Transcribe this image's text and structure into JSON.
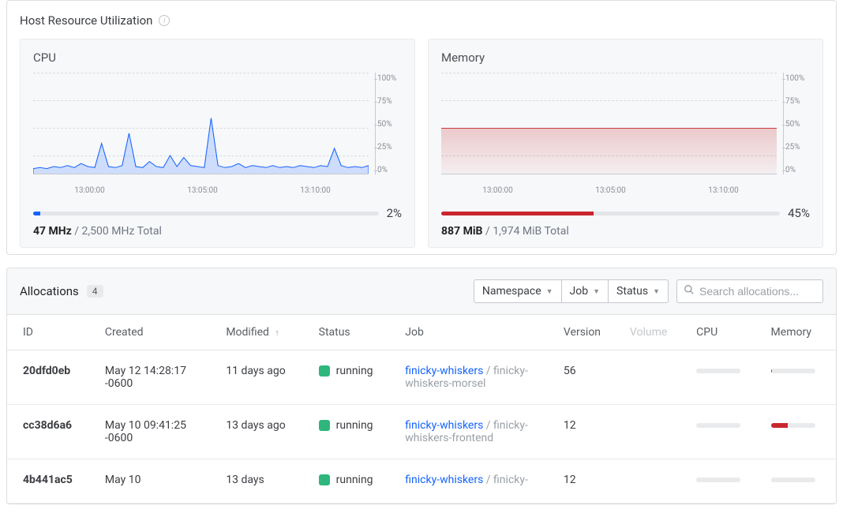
{
  "host_resource": {
    "title": "Host Resource Utilization",
    "cpu": {
      "label": "CPU",
      "pct": 2,
      "primary": "47 MHz",
      "secondary": "/ 2,500 MHz Total",
      "bar_color": "#1563ff"
    },
    "memory": {
      "label": "Memory",
      "pct": 45,
      "primary": "887 MiB",
      "secondary": "/ 1,974 MiB Total",
      "bar_color": "#c9262d"
    },
    "y_ticks": [
      "100%",
      "75%",
      "50%",
      "25%",
      "0%"
    ],
    "x_ticks": [
      "13:00:00",
      "13:05:00",
      "13:10:00"
    ]
  },
  "chart_data": [
    {
      "type": "line",
      "title": "CPU",
      "ylabel": "percent",
      "ylim": [
        0,
        100
      ],
      "x_ticks": [
        "13:00:00",
        "13:05:00",
        "13:10:00"
      ],
      "series": [
        {
          "name": "cpu",
          "color": "#1563ff",
          "values": [
            5,
            6,
            5,
            7,
            6,
            8,
            6,
            10,
            7,
            6,
            30,
            7,
            6,
            8,
            40,
            7,
            6,
            12,
            7,
            6,
            18,
            7,
            16,
            8,
            7,
            6,
            55,
            8,
            6,
            7,
            10,
            6,
            8,
            7,
            6,
            8,
            6,
            7,
            6,
            8,
            7,
            6,
            8,
            7,
            25,
            8,
            6,
            7,
            6,
            8
          ]
        }
      ]
    },
    {
      "type": "area",
      "title": "Memory",
      "ylabel": "percent",
      "ylim": [
        0,
        100
      ],
      "x_ticks": [
        "13:00:00",
        "13:05:00",
        "13:10:00"
      ],
      "series": [
        {
          "name": "memory",
          "color": "#c73e3e",
          "values": [
            45,
            45,
            45,
            45,
            45,
            45,
            45,
            45,
            45,
            45,
            45,
            45,
            45,
            45,
            45,
            45,
            45,
            45,
            45,
            45,
            45,
            45,
            45,
            45,
            45,
            45,
            45,
            45,
            45,
            45,
            45,
            45,
            45,
            45,
            45,
            45,
            45,
            45,
            45,
            45,
            45,
            45,
            45,
            45,
            45,
            45,
            45
          ]
        }
      ]
    }
  ],
  "allocations": {
    "title": "Allocations",
    "count": 4,
    "facets": [
      "Namespace",
      "Job",
      "Status"
    ],
    "search_placeholder": "Search allocations...",
    "columns": {
      "id": "ID",
      "created": "Created",
      "modified": "Modified",
      "status": "Status",
      "job": "Job",
      "version": "Version",
      "volume": "Volume",
      "cpu": "CPU",
      "memory": "Memory"
    },
    "rows": [
      {
        "id": "20dfd0eb",
        "created": "May 12 14:28:17 -0600",
        "modified": "11 days ago",
        "status": "running",
        "job_link": "finicky-whiskers",
        "job_sub": "finicky-whiskers-morsel",
        "version": "56",
        "cpu_pct": 0,
        "mem_pct": 3
      },
      {
        "id": "cc38d6a6",
        "created": "May 10 09:41:25 -0600",
        "modified": "13 days ago",
        "status": "running",
        "job_link": "finicky-whiskers",
        "job_sub": "finicky-whiskers-frontend",
        "version": "12",
        "cpu_pct": 0,
        "mem_pct": 38
      },
      {
        "id": "4b441ac5",
        "created": "May 10",
        "modified": "13 days",
        "status": "running",
        "job_link": "finicky-whiskers",
        "job_sub": "finicky-",
        "version": "12",
        "cpu_pct": 0,
        "mem_pct": 0
      }
    ]
  }
}
